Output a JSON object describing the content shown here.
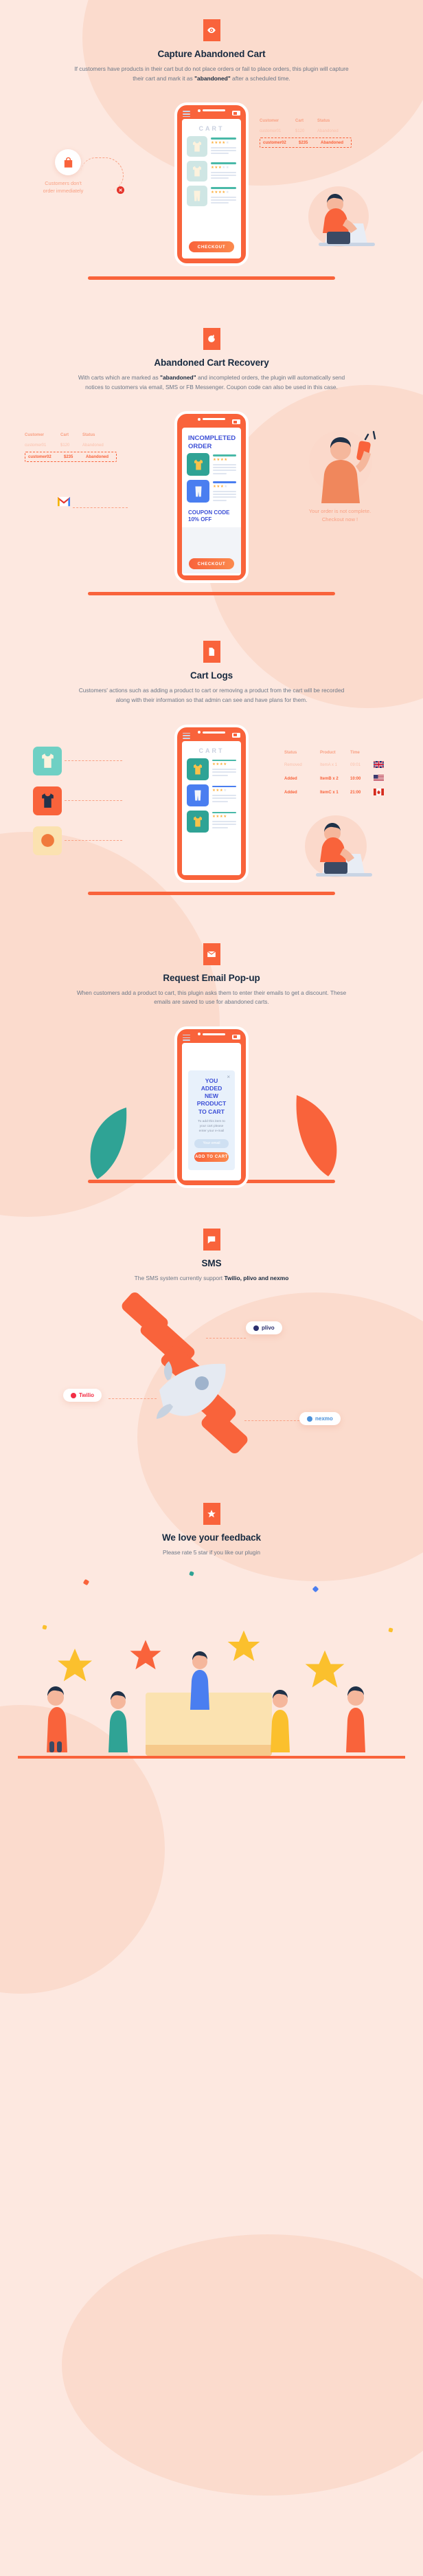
{
  "theme": {
    "bg": "#fde8e0",
    "blob": "#fbdbcd",
    "accent": "#f9633b",
    "heading": "#16293f",
    "body_text": "#6b7787",
    "muted_orange": "#f9a184"
  },
  "sections": [
    {
      "id": "capture-abandoned-cart",
      "icon": "eye-icon",
      "title": "Capture Abandoned Cart",
      "desc_parts": [
        {
          "t": "If customers have products in their cart but do not place orders or fail to place orders, this plugin will capture their cart and mark it as ",
          "b": false
        },
        {
          "t": "\"abandoned\"",
          "b": true
        },
        {
          "t": " after a scheduled time.",
          "b": false
        }
      ],
      "phone": {
        "screen_title": "CART",
        "checkout_label": "CHECKOUT"
      },
      "table": {
        "headers": [
          "Customer",
          "Cart",
          "Status"
        ],
        "rows": [
          [
            "customer01",
            "$120",
            "Abandoned"
          ]
        ],
        "highlight_row": [
          "customer02",
          "$235",
          "Abandoned"
        ]
      },
      "note": {
        "icon": "shopping-bag-icon",
        "text_line1": "Customers don't",
        "text_line2": "order immediately",
        "marker": "x"
      }
    },
    {
      "id": "abandoned-cart-recovery",
      "icon": "refresh-icon",
      "title": "Abandoned Cart Recovery",
      "desc_parts": [
        {
          "t": "With carts which are marked as ",
          "b": false
        },
        {
          "t": "\"abandoned\"",
          "b": true
        },
        {
          "t": " and incompleted orders, the plugin will automatically send notices to customers via email, SMS or FB Messenger.  Coupon code can also be used in this case.",
          "b": false
        }
      ],
      "phone": {
        "screen_title_line1": "INCOMPLETED",
        "screen_title_line2": "ORDER",
        "coupon_line1": "COUPON CODE",
        "coupon_line2": "10% OFF",
        "checkout_label": "CHECKOUT"
      },
      "table": {
        "headers": [
          "Customer",
          "Cart",
          "Status"
        ],
        "rows": [
          [
            "customer01",
            "$120",
            "Abandoned"
          ]
        ],
        "highlight_row": [
          "customer02",
          "$235",
          "Abandoned"
        ]
      },
      "mail_icon": "gmail-icon",
      "note": {
        "text_line1": "Your order is not complete.",
        "text_line2": "Checkout now !"
      }
    },
    {
      "id": "cart-logs",
      "icon": "document-icon",
      "title": "Cart Logs",
      "desc_parts": [
        {
          "t": "Customers' actions such as adding a product to cart or removing a product from the cart will be recorded along with their information so that admin can see and have plans for them.",
          "b": false
        }
      ],
      "phone": {
        "screen_title": "CART"
      },
      "log_table": {
        "headers": [
          "Status",
          "Product",
          "Time",
          ""
        ],
        "rows": [
          {
            "status": "Removed",
            "product": "ItemA x 1",
            "time": "09:01",
            "flag": "uk-flag",
            "dim": true
          },
          {
            "status": "Added",
            "product": "ItemB x 2",
            "time": "10:00",
            "flag": "us-flag",
            "dim": false
          },
          {
            "status": "Added",
            "product": "ItemC x 1",
            "time": "21:00",
            "flag": "canada-flag",
            "dim": false
          }
        ]
      }
    },
    {
      "id": "request-email-popup",
      "icon": "envelope-icon",
      "title": "Request Email Pop-up",
      "desc_parts": [
        {
          "t": "When customers add a product to cart, this plugin asks them to enter their emails to get a discount. These emails are saved to use for abandoned carts.",
          "b": false
        }
      ],
      "popup": {
        "title_line1": "YOU ADDED",
        "title_line2": "NEW PRODUCT",
        "title_line3": "TO CART",
        "body": "To add this item to your cart please enter your e-mail",
        "input_placeholder": "Your email",
        "submit_label": "ADD TO CART",
        "close_label": "×"
      }
    },
    {
      "id": "sms",
      "icon": "chat-bubble-icon",
      "title": "SMS",
      "desc_parts": [
        {
          "t": "The SMS system currently support ",
          "b": false
        },
        {
          "t": "Twilio, plivo and nexmo",
          "b": true
        }
      ],
      "providers": [
        {
          "name": "plivo",
          "color": "#2b2f6e"
        },
        {
          "name": "Twilio",
          "color": "#f22f46"
        },
        {
          "name": "nexmo",
          "color": "#4a90d9"
        }
      ]
    },
    {
      "id": "we-love-your-feedback",
      "icon": "star-icon",
      "title": "We love your feedback",
      "desc_parts": [
        {
          "t": "Please rate 5 star if you like our plugin",
          "b": false
        }
      ]
    }
  ]
}
